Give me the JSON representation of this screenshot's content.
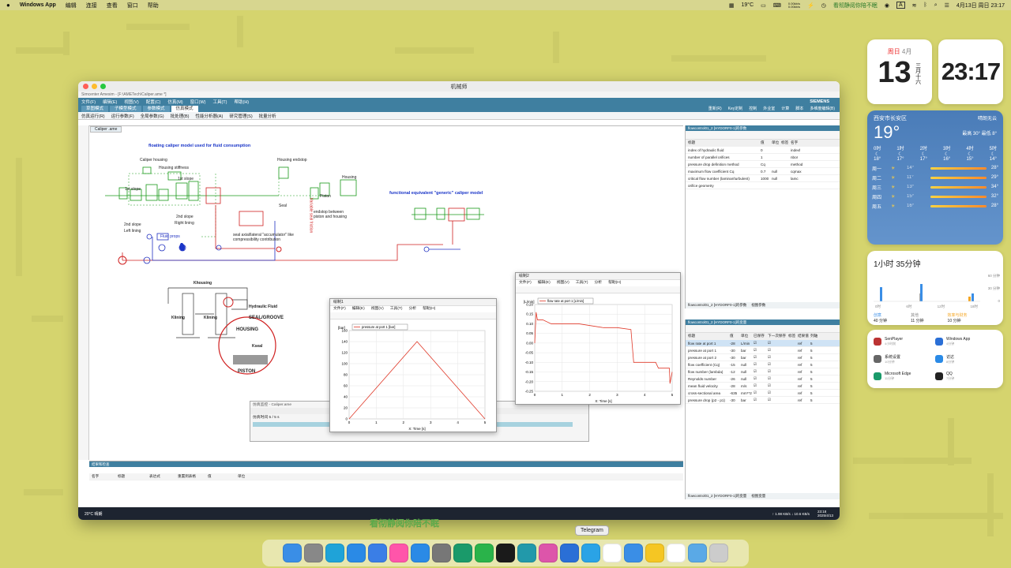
{
  "menubar": {
    "app": "Windows App",
    "items": [
      "编辑",
      "连接",
      "查看",
      "窗口",
      "帮助"
    ],
    "status_text": "看彻静阅你陪不眠",
    "temp": "19°C",
    "datetime": "4月13日 周日 23:17",
    "net_up": "0.00kb/s",
    "net_down": "0.00kb/s",
    "input_method": "A"
  },
  "window": {
    "title": "机械师",
    "app_title": "Simcenter Amesim - [F:\\AMETech\\Caliper.ame *]",
    "menus": [
      "文件(F)",
      "编辑(E)",
      "视图(V)",
      "配置(C)",
      "仿真(M)",
      "窗口(W)",
      "工具(T)",
      "帮助(H)"
    ],
    "tabs": [
      "草图模式",
      "子模型模式",
      "参数模式",
      "仿真模式"
    ],
    "right_tools": [
      "重新(R)",
      "Key定制",
      "控制",
      "外业室",
      "计算",
      "脚本",
      "多维度编辑(B)"
    ],
    "brand": "SIEMENS",
    "toolbar": [
      "仿真运行(R)",
      "运行参数(F)",
      "全局参数(G)",
      "批处理(B)",
      "性能分析器(A)",
      "研究管理(S)",
      "批量分析"
    ],
    "doc_tab": "Caliper .ame"
  },
  "diagram": {
    "title1": "floating caliper model used for fluid consumption",
    "title2": "functional equivalent \"generic\" caliper model",
    "labels": [
      "Caliper housing",
      "Housing stiffness",
      "1st slope",
      "2nd slope",
      "Left lining",
      "Right lining",
      "1st slope",
      "2nd slope",
      "Housing endstop",
      "Housing",
      "Piston",
      "Seal",
      "endstop between piston and housing",
      "seal axial/lateral \"accumulator\" like compressibility contribution",
      "Variable seal friction",
      "Fluid props"
    ],
    "sketch_labels": {
      "housing": "Khousing",
      "lining1": "Klining",
      "lining2": "Klining",
      "fluid": "Hydraulic Fluid",
      "seal": "SEAL/GROOVE",
      "h": "HOUSING",
      "kseal": "Kseal",
      "piston": "PISTON"
    }
  },
  "params_panel": {
    "header": "flowcontrol01_2 [HYDORF0-1]的参数",
    "columns": [
      "标题",
      "值",
      "单位",
      "标签",
      "名字"
    ],
    "rows": [
      {
        "title": "index of hydraulic fluid",
        "value": "0",
        "unit": "",
        "name": "indexf"
      },
      {
        "title": "number of parallel orifices",
        "value": "1",
        "unit": "",
        "name": "nbor"
      },
      {
        "title": "pressure drop definition method",
        "value": "Cq",
        "unit": "",
        "name": "method"
      },
      {
        "title": "maximum flow coefficient Cq",
        "value": "0.7",
        "unit": "null",
        "name": "cqmax"
      },
      {
        "title": "critical flow number (laminar/turbulent)",
        "value": "1000",
        "unit": "null",
        "name": "lamc"
      },
      {
        "title": "orifice geometry",
        "value": "",
        "unit": "",
        "name": ""
      }
    ],
    "tabs": [
      "flowcontrol01_2 [HYDORF0-1]的参数",
      "视图参数"
    ]
  },
  "vars_panel": {
    "header": "flowcontrol01_2 [HYDORF0-1]的变量",
    "columns": [
      "标题",
      "值",
      "单位",
      "已保存",
      "下一次保存",
      "标签",
      "结果值",
      "列轴"
    ],
    "rows": [
      {
        "title": "flow rate at port 1",
        "value": "-28",
        "unit": "L/min"
      },
      {
        "title": "pressure at port 1",
        "value": "-30",
        "unit": "bar"
      },
      {
        "title": "pressure at port 2",
        "value": "-30",
        "unit": "bar"
      },
      {
        "title": "flow coefficient (Cq)",
        "value": "-15",
        "unit": "null"
      },
      {
        "title": "flow number (lambda)",
        "value": "-12",
        "unit": "null"
      },
      {
        "title": "Reynolds number",
        "value": "-26",
        "unit": "null"
      },
      {
        "title": "mean fluid velocity",
        "value": "-28",
        "unit": "m/s"
      },
      {
        "title": "cross-sectional area",
        "value": "-635",
        "unit": "mm**2"
      },
      {
        "title": "pressure drop (p2 - p1)",
        "value": "-30",
        "unit": "bar"
      }
    ],
    "ref": "ref",
    "num": "5",
    "tabs": [
      "flowcontrol01_2 [HYDORF0-1]的变量",
      "视图变量"
    ]
  },
  "sim_dialog": {
    "title": "仿真监控 - Caliper.ame",
    "progress_label": "仿真时间 5 / 5 s"
  },
  "result_panel": {
    "header": "结果和检查",
    "columns": [
      "名字",
      "标题",
      "表达式",
      "重置到表格",
      "值",
      "单位"
    ]
  },
  "plot1": {
    "title": "绘制1",
    "menus": [
      "文件(F)",
      "编辑(E)",
      "视图(V)",
      "工具(T)",
      "分析",
      "帮助(H)"
    ],
    "legend": "pressure at port 1 [bar]",
    "ylabel": "[bar]",
    "xlabel": "X: Time [s]"
  },
  "plot2": {
    "title": "绘制2",
    "menus": [
      "文件(F)",
      "编辑(E)",
      "视图(V)",
      "工具(T)",
      "分析",
      "帮助(H)"
    ],
    "legend": "flow rate at port 1 [L/min]",
    "ylabel": "[L/min]",
    "xlabel": "X: Time [s]"
  },
  "chart_data": [
    {
      "type": "line",
      "legend": "pressure at port 1 [bar]",
      "x": [
        0,
        2.5,
        5
      ],
      "series": [
        {
          "name": "pressure at port 1 [bar]",
          "values": [
            0,
            140,
            0
          ]
        }
      ],
      "xlabel": "X: Time [s]",
      "ylabel": "[bar]",
      "xlim": [
        0,
        5
      ],
      "ylim": [
        0,
        160
      ],
      "xticks": [
        "0",
        "1",
        "2",
        "3",
        "4",
        "5"
      ],
      "yticks": [
        "0",
        "20",
        "40",
        "60",
        "80",
        "100",
        "120",
        "140",
        "160"
      ]
    },
    {
      "type": "line",
      "legend": "flow rate at port 1 [L/min]",
      "x": [
        0,
        0.05,
        0.1,
        0.3,
        0.6,
        0.8,
        1.6,
        2.5,
        2.6,
        3.0,
        3.5,
        3.6,
        4.4,
        4.5,
        4.9,
        4.92,
        5.0
      ],
      "series": [
        {
          "name": "flow rate at port 1 [L/min]",
          "values": [
            0,
            0.16,
            0.12,
            0.12,
            0.1,
            0.1,
            0.1,
            0.08,
            0.08,
            0.08,
            0.07,
            -0.1,
            -0.1,
            -0.13,
            -0.13,
            -0.21,
            -0.15
          ]
        }
      ],
      "xlabel": "X: Time [s]",
      "ylabel": "[L/min]",
      "xlim": [
        0,
        5
      ],
      "ylim": [
        -0.25,
        0.2
      ],
      "xticks": [
        "0",
        "1",
        "2",
        "3",
        "4",
        "5"
      ],
      "yticks": [
        "0.20",
        "0.15",
        "0.10",
        "0.05",
        "0.00",
        "-0.05",
        "-0.10",
        "-0.15",
        "-0.20",
        "-0.25"
      ]
    }
  ],
  "taskbar": {
    "weather": "20°C 晴朗",
    "time": "23:18",
    "date": "2025/4/13",
    "net": "↑ 1.98 KB/s ↓ 10.6 KB/s"
  },
  "widgets": {
    "calendar": {
      "weekday": "周日",
      "month": "4月",
      "day": "13",
      "lunar": "三月十六"
    },
    "clock": "23:17",
    "weather": {
      "city": "西安市长安区",
      "temp": "19°",
      "cond": "晴朗无云",
      "range": "最高 30° 最低 8°",
      "hours": [
        {
          "h": "0时",
          "t": "18°"
        },
        {
          "h": "1时",
          "t": "17°"
        },
        {
          "h": "2时",
          "t": "17°"
        },
        {
          "h": "3时",
          "t": "16°"
        },
        {
          "h": "4时",
          "t": "15°"
        },
        {
          "h": "5时",
          "t": "14°"
        }
      ],
      "days": [
        {
          "d": "周一",
          "lo": "14°",
          "hi": "28°"
        },
        {
          "d": "周二",
          "lo": "11°",
          "hi": "29°"
        },
        {
          "d": "周三",
          "lo": "13°",
          "hi": "34°"
        },
        {
          "d": "周四",
          "lo": "15°",
          "hi": "32°"
        },
        {
          "d": "周五",
          "lo": "16°",
          "hi": "28°"
        }
      ]
    },
    "screentime": {
      "title": "1小时 35分钟",
      "axis": [
        "0时",
        "6时",
        "12时",
        "18时"
      ],
      "ylabels": [
        "60 分钟",
        "30 分钟",
        "0"
      ],
      "cats": [
        {
          "name": "创意",
          "val": "40 分钟"
        },
        {
          "name": "其他",
          "val": "11 分钟"
        },
        {
          "name": "效率与财务",
          "val": "10 分钟"
        }
      ]
    },
    "apps": [
      {
        "name": "SenPlayer",
        "time": "4小时前"
      },
      {
        "name": "Windows App",
        "time": "4分钟"
      },
      {
        "name": "系统设置",
        "time": "10分钟"
      },
      {
        "name": "访达",
        "time": "8分钟"
      },
      {
        "name": "Microsoft Edge",
        "time": "11分钟"
      },
      {
        "name": "QQ",
        "time": "7分钟"
      }
    ]
  },
  "overlay_text": "看彻静阅你陪不眠",
  "tooltip": "Telegram",
  "dock": {
    "icons": [
      "finder-icon",
      "launchpad-icon",
      "edge-icon",
      "safari-icon",
      "mail-icon",
      "photos-icon",
      "appstore-icon",
      "settings-icon",
      "infinity-icon",
      "wechat-icon",
      "qq-icon",
      "bird-icon",
      "game-icon",
      "windows-icon",
      "telegram-icon",
      "chrome-icon",
      "weather-icon",
      "bulb-icon",
      "calendar-icon",
      "folder-icon",
      "trash-icon"
    ],
    "calendar_day": "13"
  }
}
